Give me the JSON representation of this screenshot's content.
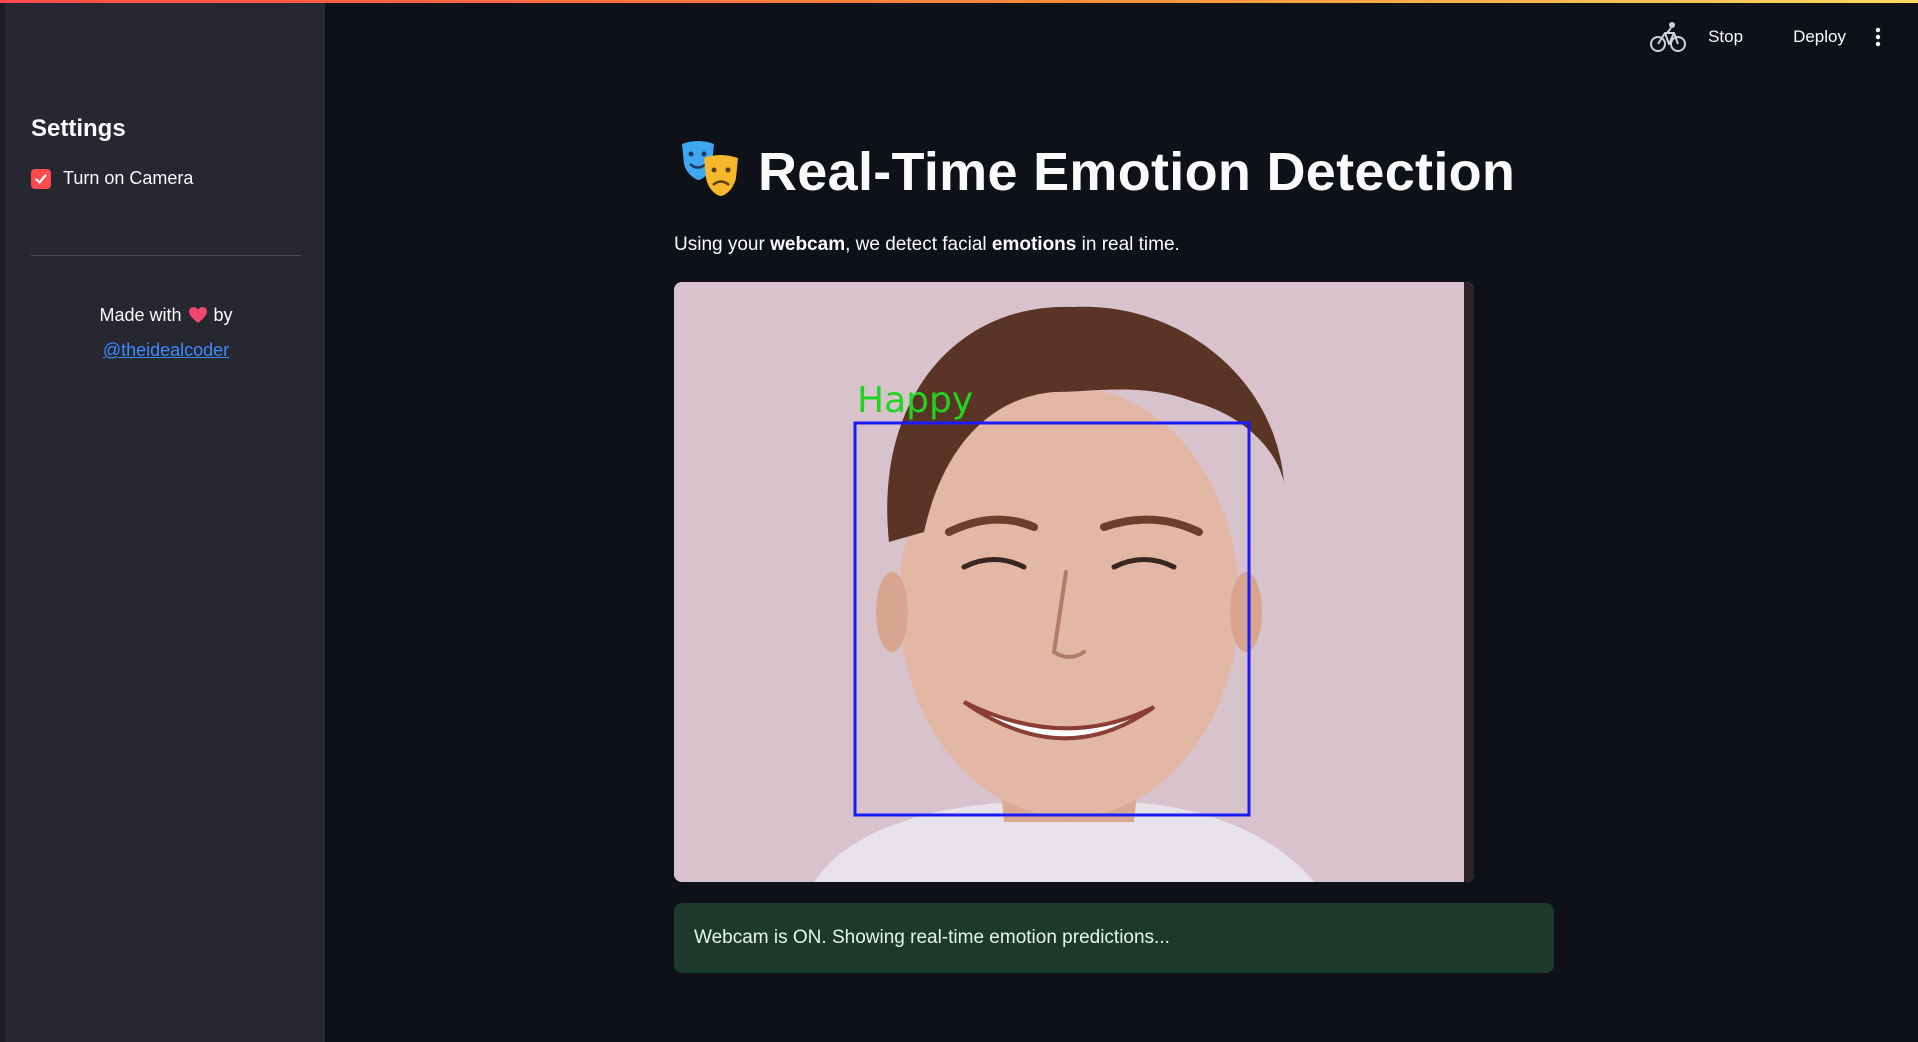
{
  "sidebar": {
    "title": "Settings",
    "camera_checkbox": {
      "label": "Turn on Camera",
      "checked": true
    },
    "footer": {
      "made_with": "Made with",
      "by": "by",
      "author": "@theidealcoder"
    }
  },
  "toolbar": {
    "stop_label": "Stop",
    "deploy_label": "Deploy"
  },
  "main": {
    "title": "Real-Time Emotion Detection",
    "subtitle": {
      "part1": "Using your ",
      "bold1": "webcam",
      "part2": ", we detect facial ",
      "bold2": "emotions",
      "part3": " in real time."
    },
    "camera": {
      "emotion_label": "Happy"
    },
    "status_message": "Webcam is ON. Showing real-time emotion predictions..."
  },
  "colors": {
    "accent": "#ff4b4b",
    "link": "#3d8cff",
    "face_box": "#1a1aff",
    "emotion_text": "#22d422",
    "status_bg": "#1b3a2b"
  }
}
